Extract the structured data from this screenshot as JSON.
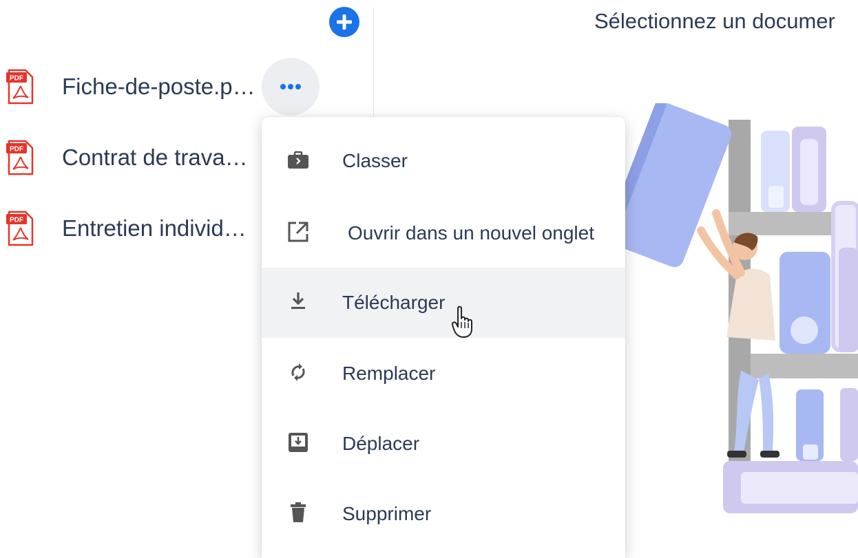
{
  "header": {
    "add_button_icon": "plus-circle-icon",
    "panel_title": "Sélectionnez un documer"
  },
  "files": [
    {
      "name": "Fiche-de-poste.p…",
      "icon": "pdf-file-icon"
    },
    {
      "name": "Contrat de trava…",
      "icon": "pdf-file-icon"
    },
    {
      "name": "Entretien individ…",
      "icon": "pdf-file-icon"
    }
  ],
  "more_button_icon": "more-horizontal-icon",
  "menu": {
    "items": [
      {
        "label": "Classer",
        "icon": "briefcase-icon"
      },
      {
        "label": "Ouvrir dans un nouvel onglet",
        "icon": "open-in-new-icon"
      },
      {
        "label": "Télécharger",
        "icon": "download-icon",
        "hovered": true
      },
      {
        "label": "Remplacer",
        "icon": "sync-icon"
      },
      {
        "label": "Déplacer",
        "icon": "move-to-inbox-icon"
      },
      {
        "label": "Supprimer",
        "icon": "trash-icon"
      }
    ]
  },
  "colors": {
    "accent": "#1a73e8",
    "text": "#2b3a55",
    "pdf_red": "#e5352b",
    "menu_hover": "#f1f2f4",
    "illustration_blue": "#a8b8f2",
    "illustration_lilac": "#cfc9f0",
    "illustration_gray": "#a8a8a8"
  }
}
